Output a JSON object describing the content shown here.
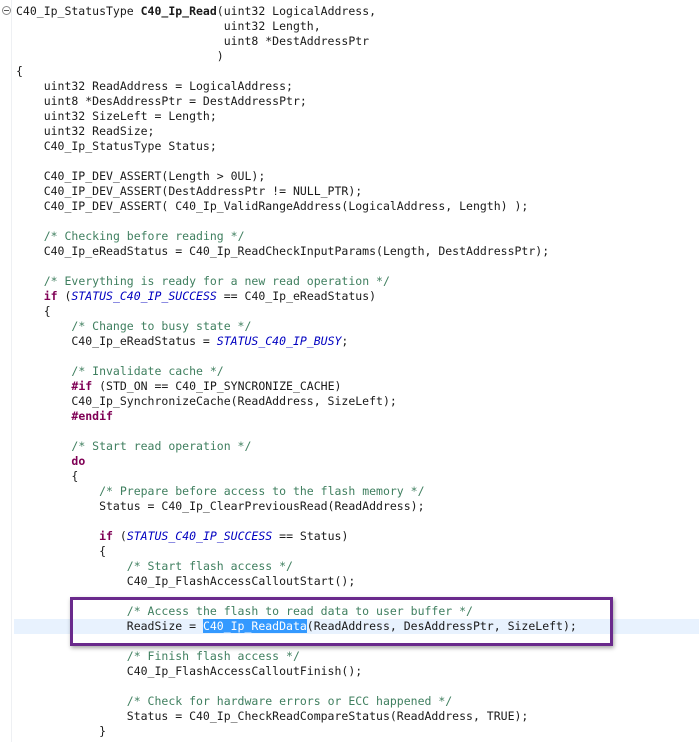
{
  "colors": {
    "comment": "#3f7f5f",
    "keyword": "#7f0055",
    "macro": "#0000c0",
    "selection": "#3399ff",
    "current_line": "#e8f2fe",
    "callout_border": "#6a2a8c"
  },
  "fold_icon": "collapse-icon",
  "current_line_index": 41,
  "lines": [
    [
      {
        "t": "C40_Ip_StatusType "
      },
      {
        "t": "C40_Ip_Read",
        "c": "bd"
      },
      {
        "t": "(uint32 LogicalAddress,"
      }
    ],
    [
      {
        "t": "                              uint32 Length,"
      }
    ],
    [
      {
        "t": "                              uint8 *DestAddressPtr"
      }
    ],
    [
      {
        "t": "                             )"
      }
    ],
    [
      {
        "t": "{"
      }
    ],
    [
      {
        "t": "    uint32 ReadAddress = LogicalAddress;"
      }
    ],
    [
      {
        "t": "    uint8 *DesAddressPtr = DestAddressPtr;"
      }
    ],
    [
      {
        "t": "    uint32 SizeLeft = Length;"
      }
    ],
    [
      {
        "t": "    uint32 ReadSize;"
      }
    ],
    [
      {
        "t": "    C40_Ip_StatusType Status;"
      }
    ],
    [],
    [
      {
        "t": "    C40_IP_DEV_ASSERT(Length > 0UL);"
      }
    ],
    [
      {
        "t": "    C40_IP_DEV_ASSERT(DestAddressPtr != NULL_PTR);"
      }
    ],
    [
      {
        "t": "    C40_IP_DEV_ASSERT( C40_Ip_ValidRangeAddress(LogicalAddress, Length) );"
      }
    ],
    [],
    [
      {
        "t": "    "
      },
      {
        "t": "/* Checking before reading */",
        "c": "cm"
      }
    ],
    [
      {
        "t": "    C40_Ip_eReadStatus = C40_Ip_ReadCheckInputParams(Length, DestAddressPtr);"
      }
    ],
    [],
    [
      {
        "t": "    "
      },
      {
        "t": "/* Everything is ready for a new read operation */",
        "c": "cm"
      }
    ],
    [
      {
        "t": "    "
      },
      {
        "t": "if",
        "c": "kw"
      },
      {
        "t": " ("
      },
      {
        "t": "STATUS_C40_IP_SUCCESS",
        "c": "mc"
      },
      {
        "t": " == C40_Ip_eReadStatus)"
      }
    ],
    [
      {
        "t": "    {"
      }
    ],
    [
      {
        "t": "        "
      },
      {
        "t": "/* Change to busy state */",
        "c": "cm"
      }
    ],
    [
      {
        "t": "        C40_Ip_eReadStatus = "
      },
      {
        "t": "STATUS_C40_IP_BUSY",
        "c": "mc"
      },
      {
        "t": ";"
      }
    ],
    [],
    [
      {
        "t": "        "
      },
      {
        "t": "/* Invalidate cache */",
        "c": "cm"
      }
    ],
    [
      {
        "t": "        "
      },
      {
        "t": "#if",
        "c": "kw"
      },
      {
        "t": " (STD_ON == C40_IP_SYNCRONIZE_CACHE)"
      }
    ],
    [
      {
        "t": "        C40_Ip_SynchronizeCache(ReadAddress, SizeLeft);"
      }
    ],
    [
      {
        "t": "        "
      },
      {
        "t": "#endif",
        "c": "kw"
      }
    ],
    [],
    [
      {
        "t": "        "
      },
      {
        "t": "/* Start read operation */",
        "c": "cm"
      }
    ],
    [
      {
        "t": "        "
      },
      {
        "t": "do",
        "c": "kw"
      }
    ],
    [
      {
        "t": "        {"
      }
    ],
    [
      {
        "t": "            "
      },
      {
        "t": "/* Prepare before access to the flash memory */",
        "c": "cm"
      }
    ],
    [
      {
        "t": "            Status = C40_Ip_ClearPreviousRead(ReadAddress);"
      }
    ],
    [],
    [
      {
        "t": "            "
      },
      {
        "t": "if",
        "c": "kw"
      },
      {
        "t": " ("
      },
      {
        "t": "STATUS_C40_IP_SUCCESS",
        "c": "mc"
      },
      {
        "t": " == Status)"
      }
    ],
    [
      {
        "t": "            {"
      }
    ],
    [
      {
        "t": "                "
      },
      {
        "t": "/* Start flash access */",
        "c": "cm"
      }
    ],
    [
      {
        "t": "                C40_Ip_FlashAccessCalloutStart();"
      }
    ],
    [],
    [
      {
        "t": "                "
      },
      {
        "t": "/* Access the flash to read data to user buffer */",
        "c": "cm"
      }
    ],
    [
      {
        "t": "                ReadSize = "
      },
      {
        "t": "C40_Ip_ReadData",
        "c": "sel"
      },
      {
        "t": "(ReadAddress, DesAddressPtr, SizeLeft);"
      }
    ],
    [],
    [
      {
        "t": "                "
      },
      {
        "t": "/* Finish flash access */",
        "c": "cm"
      }
    ],
    [
      {
        "t": "                C40_Ip_FlashAccessCalloutFinish();"
      }
    ],
    [],
    [
      {
        "t": "                "
      },
      {
        "t": "/* Check for hardware errors or ECC happened */",
        "c": "cm"
      }
    ],
    [
      {
        "t": "                Status = C40_Ip_CheckReadCompareStatus(ReadAddress, TRUE);"
      }
    ],
    [
      {
        "t": "            }"
      }
    ]
  ]
}
